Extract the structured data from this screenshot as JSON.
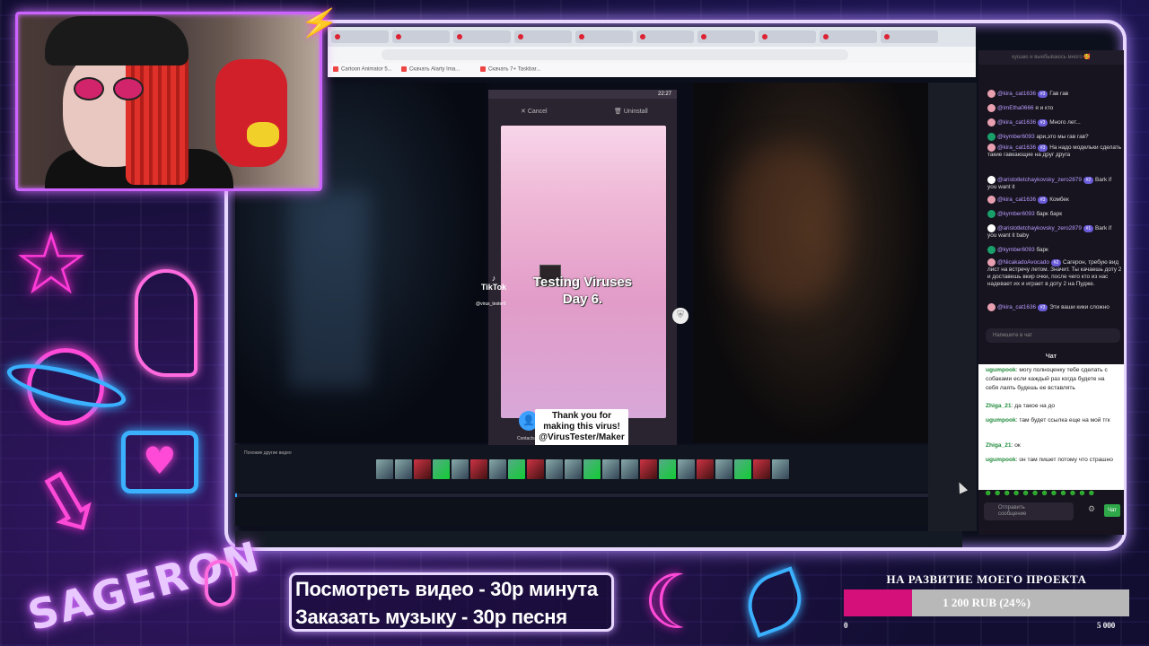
{
  "browser": {
    "tabs_count": 10,
    "bookmarks": [
      "Cartoon Animator 5...",
      "Скачать Alarty Ima...",
      "Скачать 7+ Taskbar..."
    ]
  },
  "video": {
    "phone_time": "22:27",
    "cancel_label": "Cancel",
    "uninstall_label": "Uninstall",
    "title_line1": "Testing Viruses",
    "title_line2": "Day 6.",
    "tiktok_logo": "TikTok",
    "tiktok_handle": "@virus_tester6",
    "contacts_label": "Contacts",
    "caption_line1": "Thank you for",
    "caption_line2": "making this virus!",
    "caption_line3": "@VirusTester/Maker",
    "strip_label": "Похожие другие видео"
  },
  "chat": {
    "top_line": "кушаю и выебываюсь много 🥰",
    "messages": [
      {
        "user": "@kira_cat1636",
        "badge": "#3",
        "text": "Гав гав"
      },
      {
        "user": "@imEtha0666",
        "badge": "",
        "text": "я и кто"
      },
      {
        "user": "@kira_cat1636",
        "badge": "#3",
        "text": "Много лет..."
      },
      {
        "user": "@kymber6093",
        "badge": "",
        "text": "ари,это мы гав гав?"
      },
      {
        "user": "@kira_cat1636",
        "badge": "#3",
        "text": "На надо модельки сделать такие гавкающие на друг друга"
      },
      {
        "user": "@aristotletchaykovsky_zero2879",
        "badge": "#2",
        "text": "Bark if you want it"
      },
      {
        "user": "@kira_cat1636",
        "badge": "#3",
        "text": "Комбек"
      },
      {
        "user": "@kymber6093",
        "badge": "",
        "text": "барк барк"
      },
      {
        "user": "@aristotletchaykovsky_zero2879",
        "badge": "#1",
        "text": "Bark if you want it baby"
      },
      {
        "user": "@kymber6093",
        "badge": "",
        "text": "барк"
      },
      {
        "user": "@NicakadoAvocado",
        "badge": "#2",
        "text": "Сагерон, требую вид лист на встречу летом. Значит. Ты качаешь доту 2 и доставешь вкир очки, после чего кто из нас надевает их и играет в доту 2 на Пудже."
      },
      {
        "user": "@kira_cat1636",
        "badge": "#3",
        "text": "Эти ваши кики сложно"
      }
    ],
    "input_placeholder": "Напишите в чат",
    "second_title": "Чат",
    "second_messages": [
      {
        "user": "ugumpook",
        "text": "могу полноценку тебе сделать с собаками если каждый раз когда будете на себя лаять будешь ее вставлять"
      },
      {
        "user": "Zhiga_21",
        "text": "да такое на до"
      },
      {
        "user": "ugumpook",
        "text": "там будет ссылка еще на мой тгк"
      },
      {
        "user": "Zhiga_21",
        "text": "ок"
      },
      {
        "user": "ugumpook",
        "text": "он там пишет потому что страшно"
      }
    ],
    "send_placeholder_1": "Отправить",
    "send_placeholder_2": "сообщение",
    "send_button": "Чат"
  },
  "overlay": {
    "price_line_1": "Посмотреть видео - 30р минута",
    "price_line_2": "Заказать музыку - 30р песня",
    "brand_text": "SAGERON",
    "goal_title": "НА РАЗВИТИЕ МОЕГО ПРОЕКТА",
    "goal_text": "1 200 RUB (24%)",
    "goal_min": "0",
    "goal_max": "5 000",
    "goal_progress": 0.24
  },
  "colors": {
    "neon_pink": "#ff3ad8",
    "neon_blue": "#3ab0ff",
    "goal_fill": "#d6107a",
    "chat_green": "#1f8a3a"
  }
}
